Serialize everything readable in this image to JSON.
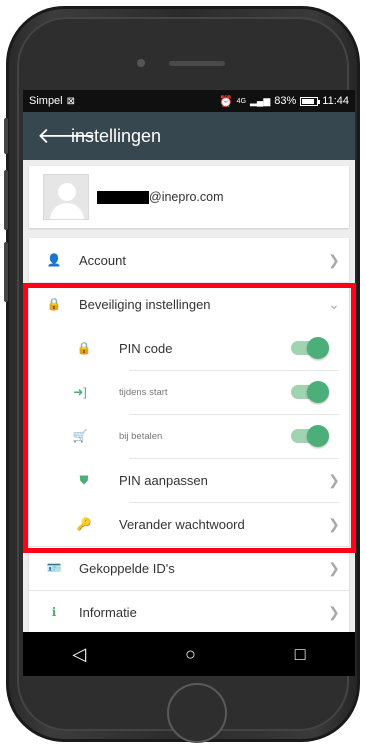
{
  "status": {
    "carrier": "Simpel",
    "signal_label": "4G",
    "battery": "83%",
    "time": "11:44"
  },
  "appbar": {
    "title": "instellingen"
  },
  "profile": {
    "email_suffix": "@inepro.com"
  },
  "menu": {
    "account": "Account",
    "security": "Beveiliging instellingen",
    "pin_code": "PIN code",
    "during_start": "tijdens start",
    "when_paying": "bij betalen",
    "pin_change": "PIN aanpassen",
    "change_password": "Verander wachtwoord",
    "linked_ids": "Gekoppelde ID's",
    "information": "Informatie"
  },
  "toggles": {
    "pin_code": true,
    "during_start": true,
    "when_paying": true
  },
  "colors": {
    "accent": "#4caf7a",
    "appbar": "#37474f",
    "highlight": "#ff0018"
  },
  "nav": {
    "back": "◁",
    "home": "○",
    "recent": "□"
  }
}
